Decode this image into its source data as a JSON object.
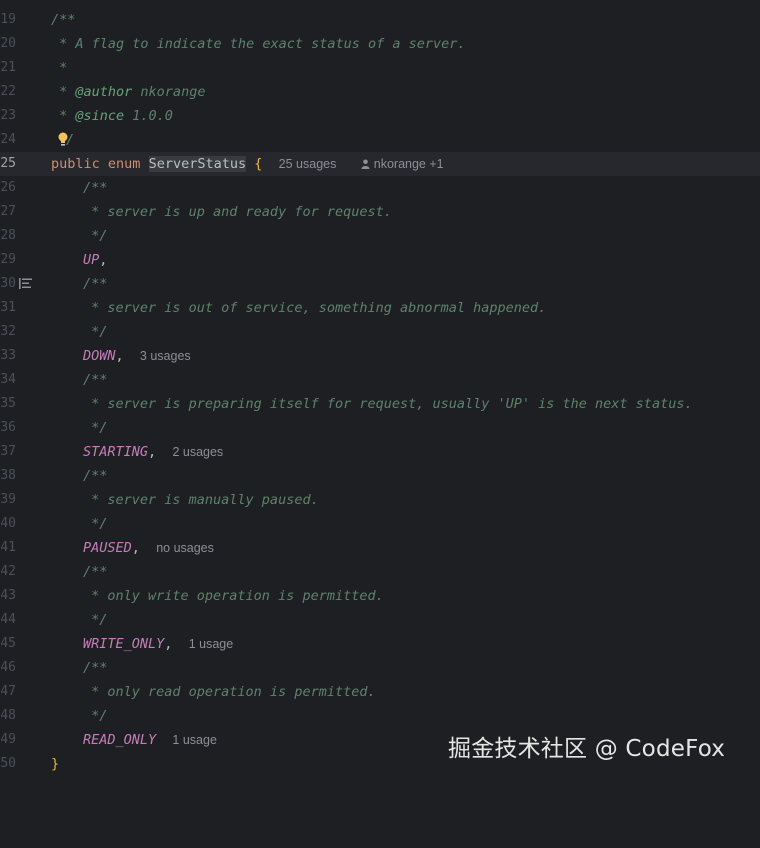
{
  "editor": {
    "lines": [
      {
        "num": "19",
        "text": "/**"
      },
      {
        "num": "20",
        "text": " * A flag to indicate the exact status of a server."
      },
      {
        "num": "21",
        "text": " *"
      },
      {
        "num": "22",
        "tag": "@author",
        "tag_value": " nkorange"
      },
      {
        "num": "23",
        "tag": "@since",
        "tag_value": " 1.0.0"
      },
      {
        "num": "24",
        "text": "/"
      },
      {
        "num": "25",
        "kw1": "public",
        "kw2": "enum",
        "name": "ServerStatus",
        "brace": "{",
        "usages": "25 usages",
        "author": "nkorange +1"
      },
      {
        "num": "26",
        "text": "/**"
      },
      {
        "num": "27",
        "text": " * server is up and ready for request."
      },
      {
        "num": "28",
        "text": " */"
      },
      {
        "num": "29",
        "const": "UP",
        "punct": ","
      },
      {
        "num": "30",
        "text": "/**"
      },
      {
        "num": "31",
        "text": " * server is out of service, something abnormal happened."
      },
      {
        "num": "32",
        "text": " */"
      },
      {
        "num": "33",
        "const": "DOWN",
        "punct": ",",
        "usages": "3 usages"
      },
      {
        "num": "34",
        "text": "/**"
      },
      {
        "num": "35",
        "text": " * server is preparing itself for request, usually 'UP' is the next status."
      },
      {
        "num": "36",
        "text": " */"
      },
      {
        "num": "37",
        "const": "STARTING",
        "punct": ",",
        "usages": "2 usages"
      },
      {
        "num": "38",
        "text": "/**"
      },
      {
        "num": "39",
        "text": " * server is manually paused."
      },
      {
        "num": "40",
        "text": " */"
      },
      {
        "num": "41",
        "const": "PAUSED",
        "punct": ",",
        "usages": "no usages"
      },
      {
        "num": "42",
        "text": "/**"
      },
      {
        "num": "43",
        "text": " * only write operation is permitted."
      },
      {
        "num": "44",
        "text": " */"
      },
      {
        "num": "45",
        "const": "WRITE_ONLY",
        "punct": ",",
        "usages": "1 usage"
      },
      {
        "num": "46",
        "text": "/**"
      },
      {
        "num": "47",
        "text": " * only read operation is permitted."
      },
      {
        "num": "48",
        "text": " */"
      },
      {
        "num": "49",
        "const": "READ_ONLY",
        "usages": "1 usage"
      },
      {
        "num": "50",
        "brace": "}"
      }
    ]
  },
  "watermark": "掘金技术社区 @ CodeFox",
  "icons": {
    "bulb": "lightbulb-icon",
    "author": "person-icon",
    "gutter": "implementations-gutter-icon"
  },
  "colors": {
    "background": "#1e1f22",
    "comment": "#5f826b",
    "keyword": "#cf8e6d",
    "enum_constant": "#c77dbb",
    "brace": "#e8ba36",
    "hint": "#8c8f96"
  }
}
